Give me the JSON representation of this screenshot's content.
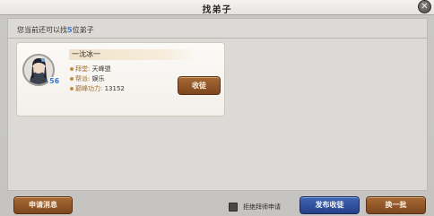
{
  "window": {
    "title": "找弟子",
    "close_glyph": "✕"
  },
  "quota": {
    "prefix": "您当前还可以找",
    "count": "5",
    "suffix": "位弟子"
  },
  "disciple": {
    "name": "一沈冰一",
    "level": "56",
    "sect_label": "拜堂:",
    "sect_value": "天峰盟",
    "faction_label": "帮派:",
    "faction_value": "娱乐",
    "power_label": "巅峰功力:",
    "power_value": "13152",
    "accept_label": "收徒"
  },
  "footer": {
    "apply_msg_label": "申请消息",
    "reject_label": "拒绝拜师申请",
    "reject_checked": false,
    "publish_label": "发布收徒",
    "refresh_label": "换一批"
  },
  "colors": {
    "brown_button": "#8e5428",
    "blue_button": "#2f4f9c",
    "accent_blue": "#3c78c9"
  }
}
